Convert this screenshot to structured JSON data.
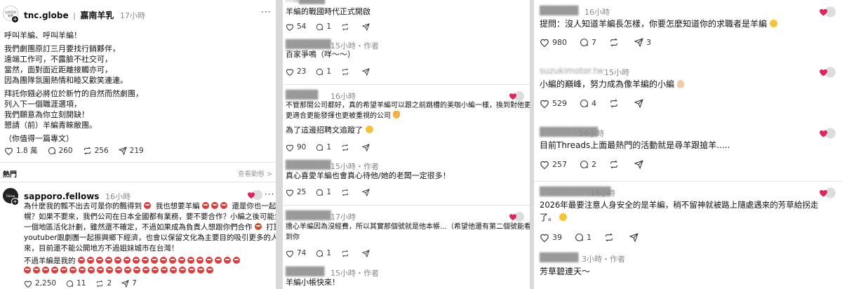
{
  "panel1": {
    "post": {
      "username": "tnc.globe",
      "separator": "|",
      "page_title": "嘉南羊乳",
      "time": "17小時",
      "lines": [
        "呼叫羊編、呼叫羊編！",
        "我們劇團原訂三月要找行銷夥伴，",
        "遠端工作可，不露臉不社交可，",
        "當然，面對面近距離接觸亦可，",
        "因為團隊氛圍熱情和睦又歡笑連連。",
        "拜託你鏹必將位於新竹的自然而然劇團，",
        "列入下一個職涯選項，",
        "我們願意為你立刻開缺！",
        "懇請（前）羊編青睞敝團。",
        "（你值得一篇專文）"
      ],
      "stats": {
        "likes": "1.8 萬",
        "comments": "260",
        "reposts": "256",
        "shares": "219"
      }
    },
    "section_title": "熱門",
    "view_activity": "查看動態 >",
    "reply": {
      "username": "sapporo.fellows",
      "time": "16小時",
      "lines": [
        "為什麼我的瓢不出去可是你的飄得到",
        "我也想要羊編",
        "還是你也一起來札",
        "幌？如果不要來，我們公司在日本全國都有業務，要不要合作？小編之後可能負責",
        "一個地區活化計劃，雖然還不確定，不過如果成為負責人想跟你們合作",
        "打算我",
        "youtuber跟劇團一起振興鄉下經濟，也會以保留文化為主要目的吸引更多的人到",
        "來，目前還不能公開地方不過姐妹城市在台灣！",
        "不過羊編是我的"
      ],
      "stats": {
        "likes": "2,250",
        "comments": "11",
        "reposts": "2",
        "shares": "7"
      }
    }
  },
  "panel2": {
    "items": [
      {
        "name": "",
        "time": "",
        "text": "羊編的戰國時代正式開啟",
        "likes": "54",
        "comments": "1"
      },
      {
        "name": "",
        "time": "15小時・作者",
        "text": "百家爭鳴（咩～～）",
        "likes": "23",
        "comments": "1"
      },
      {
        "name": "",
        "time": "16小時",
        "text1": "不管那間公司都好，真的希望羊編可以跟之前跳槽的美咖小編一樣，換到對他更",
        "text2": "更適合更能發揮也更被重視的公司",
        "likes": "",
        "comments": ""
      },
      {
        "name": "",
        "time": "",
        "text": "為了這邊招聘文追蹤了",
        "likes": "90",
        "comments": "1"
      },
      {
        "name": "",
        "time": "15小時・作者",
        "text": "真心喜愛羊編也會真心待他/她的老闆一定很多！",
        "likes": "25",
        "comments": "1"
      },
      {
        "name": "",
        "time": "17小時",
        "text1": "擔心羊編因為沒經費，所以其實那個號就是他本帳…（希望他還有第二個號能看",
        "text2": "到你",
        "likes": "74",
        "comments": "1"
      },
      {
        "name": "",
        "time": "15小時・作者",
        "text": "羊編小帳快來！",
        "likes": "",
        "comments": ""
      }
    ]
  },
  "panel3": {
    "items": [
      {
        "time": "16小時",
        "text": "提問：沒人知道羊編長怎樣，你要怎麼知道你的求職者是羊編",
        "likes": "980",
        "comments": "7",
        "reposts": "3"
      },
      {
        "time": "15小時",
        "text": "小編的巔峰，努力成為像羊編的小編",
        "likes": "529",
        "comments": "4"
      },
      {
        "time": "16小時",
        "text": "目前Threads上面最熱門的活動就是尋羊跟搶羊.....",
        "likes": "257",
        "comments": "2"
      },
      {
        "time": "14小時",
        "text1": "2026年最要注意人身安全的是羊編，稍不留神就被路上隨處遇來的芳草給拐走",
        "text2": "了。",
        "likes": "39",
        "comments": "1"
      },
      {
        "time": "3小時・作者",
        "text": "芳草碧連天～"
      }
    ]
  }
}
